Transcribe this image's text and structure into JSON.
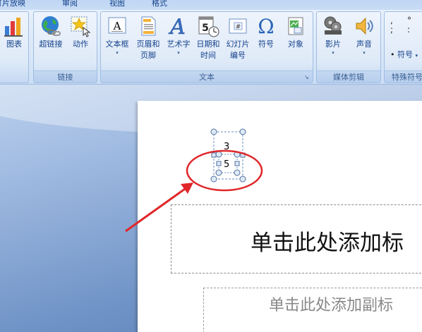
{
  "tabs": [
    "灯片放映",
    "审阅",
    "视图",
    "格式"
  ],
  "ribbon": {
    "groups": [
      {
        "label": "",
        "buttons": [
          {
            "label": "图表",
            "icon": "chart-icon"
          }
        ]
      },
      {
        "label": "链接",
        "buttons": [
          {
            "label": "超链接",
            "icon": "hyperlink-icon"
          },
          {
            "label": "动作",
            "icon": "action-icon"
          }
        ]
      },
      {
        "label": "文本",
        "buttons": [
          {
            "label": "文本框",
            "icon": "textbox-icon",
            "dropdown": true
          },
          {
            "label": "页眉和\n页脚",
            "icon": "header-footer-icon"
          },
          {
            "label": "艺术字",
            "icon": "wordart-icon",
            "dropdown": true
          },
          {
            "label": "日期和\n时间",
            "icon": "date-time-icon"
          },
          {
            "label": "幻灯片\n编号",
            "icon": "slide-number-icon"
          },
          {
            "label": "符号",
            "icon": "symbol-icon"
          },
          {
            "label": "对象",
            "icon": "object-icon"
          }
        ]
      },
      {
        "label": "媒体剪辑",
        "buttons": [
          {
            "label": "影片",
            "icon": "movie-icon",
            "dropdown": true
          },
          {
            "label": "声音",
            "icon": "sound-icon",
            "dropdown": true
          }
        ]
      },
      {
        "label": "特殊符号",
        "buttons": [
          {
            "label": "符号",
            "icon": "special-symbol-icon",
            "dropdown": true
          }
        ]
      }
    ]
  },
  "slide": {
    "title_placeholder": "单击此处添加标",
    "subtitle_placeholder": "单击此处添加副标",
    "equation": {
      "numerator": "3",
      "denominator": "5"
    }
  },
  "colors": {
    "annotation": "#e0272a",
    "ribbon_text": "#15428b"
  }
}
